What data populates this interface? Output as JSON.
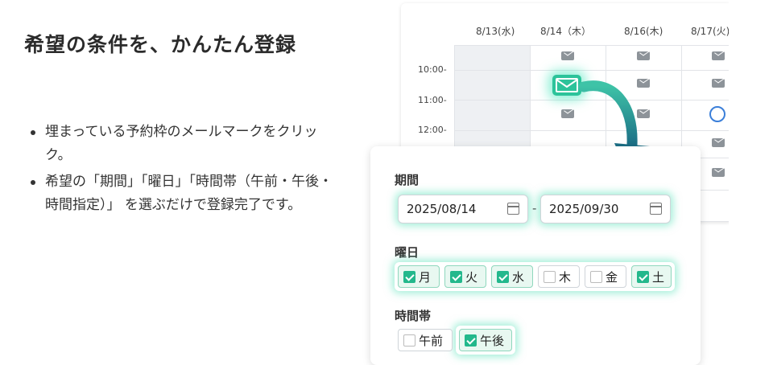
{
  "headline": "希望の条件を、かんたん登録",
  "bullets": [
    "埋まっている予約枠のメールマークをクリック。",
    "希望の「期間」「曜日」「時間帯（午前・午後・時間指定）」 を選ぶだけで登録完了です。"
  ],
  "calendar": {
    "dates": [
      "8/13(水)",
      "8/14（木）",
      "8/16(木)",
      "8/17(火)"
    ],
    "times": [
      "10:00-",
      "11:00-",
      "12:00-"
    ]
  },
  "form": {
    "period_label": "期間",
    "start_date": "2025/08/14",
    "end_date": "2025/09/30",
    "dash": "-",
    "weekday_label": "曜日",
    "weekdays": [
      {
        "label": "月",
        "checked": true
      },
      {
        "label": "火",
        "checked": true
      },
      {
        "label": "水",
        "checked": true
      },
      {
        "label": "木",
        "checked": false
      },
      {
        "label": "金",
        "checked": false
      },
      {
        "label": "土",
        "checked": true
      }
    ],
    "timeslot_label": "時間帯",
    "timeslots": [
      {
        "label": "午前",
        "checked": false
      },
      {
        "label": "午後",
        "checked": true
      }
    ]
  },
  "colors": {
    "accent": "#23b88c",
    "glow": "#5ae1b9",
    "arrow": "#1f8a8a",
    "circle": "#3b7fd9"
  }
}
